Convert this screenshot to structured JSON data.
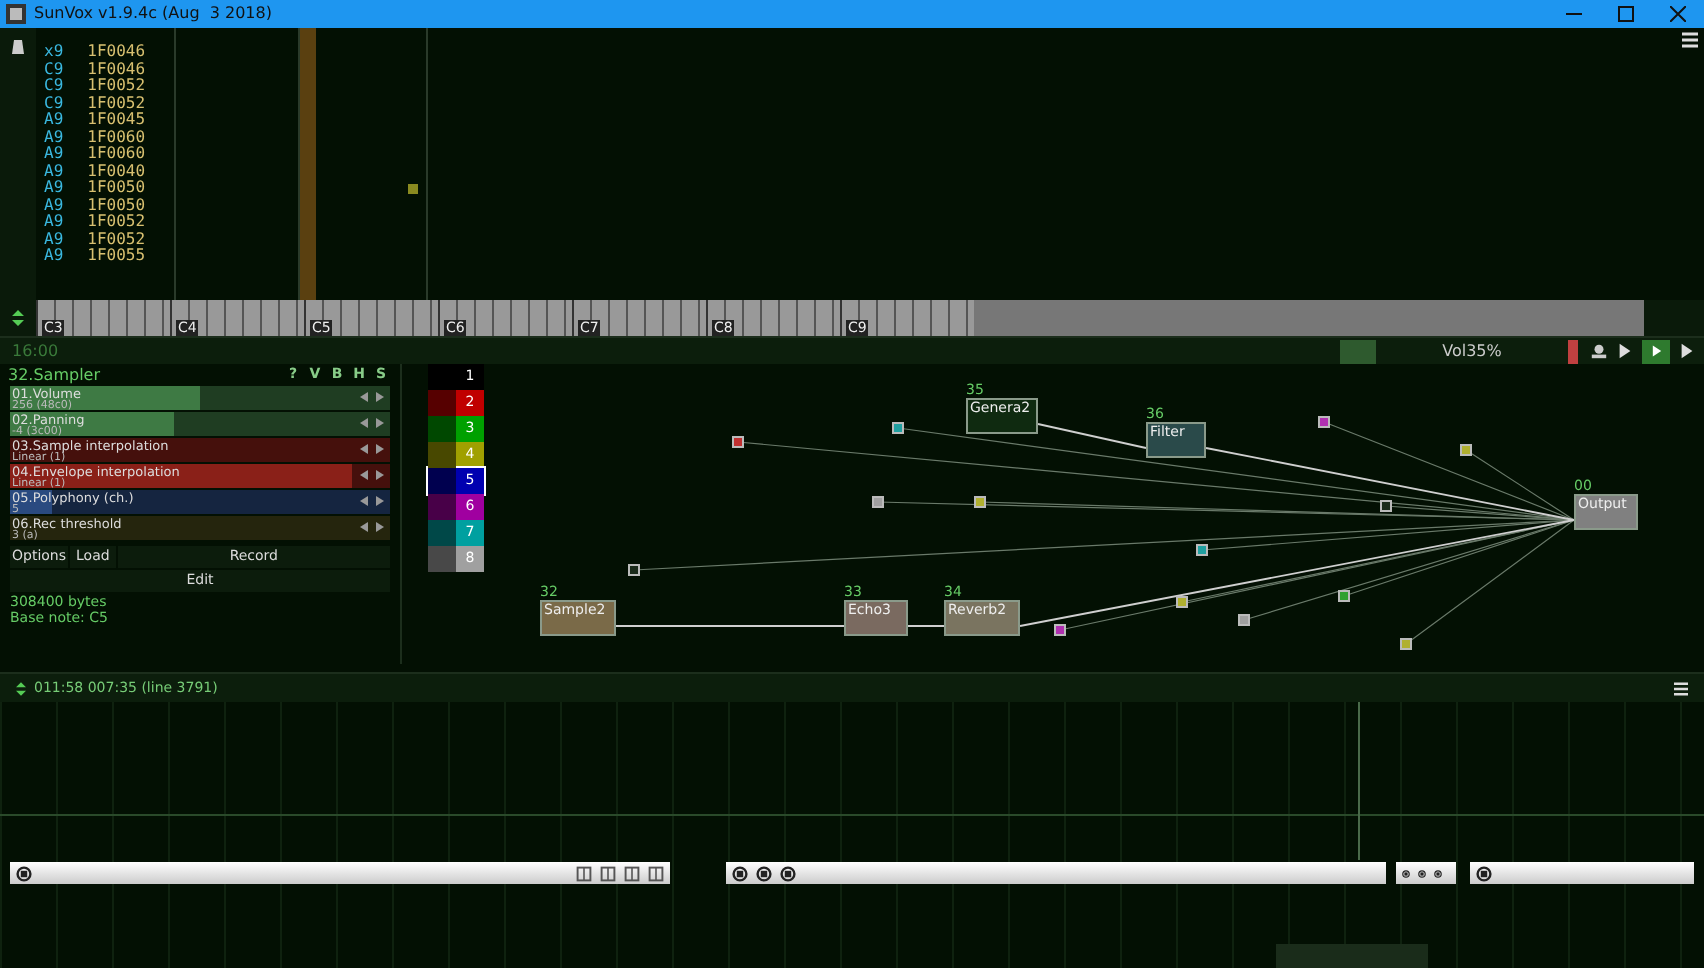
{
  "window": {
    "title": "SunVox v1.9.4c (Aug  3 2018)"
  },
  "pattern": {
    "rows": [
      {
        "note": "x9",
        "effect": "1F0046"
      },
      {
        "note": "C9",
        "effect": "1F0046"
      },
      {
        "note": "C9",
        "effect": "1F0052"
      },
      {
        "note": "C9",
        "effect": "1F0052"
      },
      {
        "note": "A9",
        "effect": "1F0045"
      },
      {
        "note": "A9",
        "effect": "1F0060"
      },
      {
        "note": "A9",
        "effect": "1F0060"
      },
      {
        "note": "A9",
        "effect": "1F0040"
      },
      {
        "note": "A9",
        "effect": "1F0050"
      },
      {
        "note": "A9",
        "effect": "1F0050"
      },
      {
        "note": "A9",
        "effect": "1F0052"
      },
      {
        "note": "A9",
        "effect": "1F0052"
      },
      {
        "note": "A9",
        "effect": "1F0055"
      }
    ]
  },
  "keyboard": {
    "octaves": [
      "C3",
      "C4",
      "C5",
      "C6",
      "C7",
      "C8",
      "C9"
    ]
  },
  "toolbar": {
    "time": "16:00",
    "volume": "Vol35%"
  },
  "module_panel": {
    "title": "32.Sampler",
    "flags": [
      "?",
      "V",
      "B",
      "H",
      "S"
    ],
    "controllers": [
      {
        "name": "01.Volume",
        "value": "256 (48c0)",
        "level": 0.5,
        "color": "#1f3d22"
      },
      {
        "name": "02.Panning",
        "value": "-4 (3c00)",
        "level": 0.43,
        "color": "#1f3d22"
      },
      {
        "name": "03.Sample interpolation",
        "value": "Linear (1)",
        "level": 0,
        "color": "#45100c"
      },
      {
        "name": "04.Envelope interpolation",
        "value": "Linear (1)",
        "level": 0.9,
        "color": "#45100c"
      },
      {
        "name": "05.Polyphony (ch.)",
        "value": "5",
        "level": 0.11,
        "color": "#152540"
      },
      {
        "name": "06.Rec threshold",
        "value": "3 (a)",
        "level": 0,
        "color": "#25250d"
      }
    ],
    "buttons": [
      "Options",
      "Load",
      "Record",
      "Edit"
    ],
    "info": [
      "308400 bytes",
      "Base note: C5"
    ]
  },
  "palette": [
    {
      "number": "1",
      "color": "#000000",
      "selected": false
    },
    {
      "number": "2",
      "color": "#c00000",
      "selected": false
    },
    {
      "number": "3",
      "color": "#00a000",
      "selected": false
    },
    {
      "number": "4",
      "color": "#a0a000",
      "selected": false
    },
    {
      "number": "5",
      "color": "#0000b0",
      "selected": true
    },
    {
      "number": "6",
      "color": "#a000a0",
      "selected": false
    },
    {
      "number": "7",
      "color": "#00a0a0",
      "selected": false
    },
    {
      "number": "8",
      "color": "#a0a0a0",
      "selected": false
    }
  ],
  "modules": [
    {
      "number": "35",
      "name": "Genera2",
      "color": "#0f2a10"
    },
    {
      "number": "36",
      "name": "Filter",
      "color": "#2a4a4a"
    },
    {
      "number": "00",
      "name": "Output",
      "color": "#808080"
    },
    {
      "number": "32",
      "name": "Sample2",
      "color": "#7a6a48"
    },
    {
      "number": "33",
      "name": "Echo3",
      "color": "#7a6a60"
    },
    {
      "number": "34",
      "name": "Reverb2",
      "color": "#7a7460"
    }
  ],
  "small_modules": [
    {
      "color": "#c03030"
    },
    {
      "color": "#20a0a0"
    },
    {
      "color": "#a0a0a0"
    },
    {
      "color": "#b0b030"
    },
    {
      "color": "#1a2a1a"
    },
    {
      "color": "#20a0a0"
    },
    {
      "color": "#b0b030"
    },
    {
      "color": "#b030b0"
    },
    {
      "color": "#a0a0a0"
    },
    {
      "color": "#30a030"
    },
    {
      "color": "#b0b030"
    },
    {
      "color": "#b030b0"
    },
    {
      "color": "#b0b030"
    },
    {
      "color": "#1a2a1a"
    }
  ],
  "timeline": {
    "position": "011:58 007:35 (line 3791)"
  }
}
